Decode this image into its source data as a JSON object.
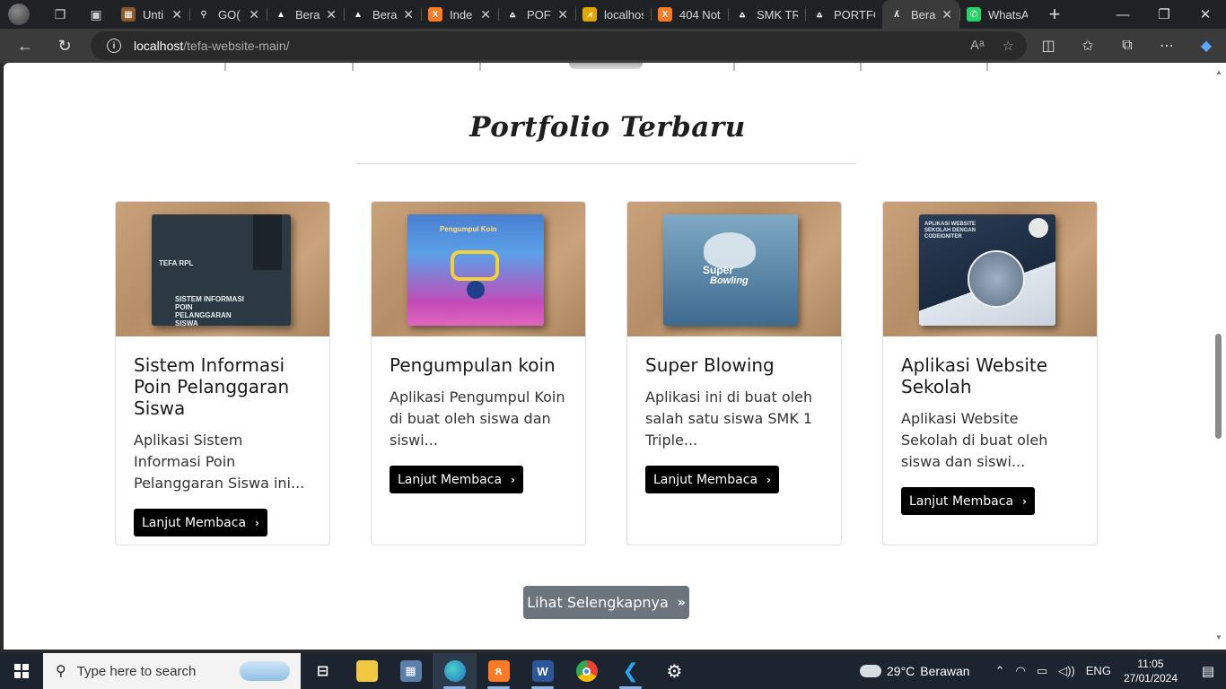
{
  "browser": {
    "tabs": [
      {
        "title": "Unti",
        "fav_color": "#8b5a2b",
        "fav_glyph": "▦",
        "active": false
      },
      {
        "title": "GO(",
        "fav_color": "#202124",
        "fav_glyph": "⚲",
        "active": false
      },
      {
        "title": "Bera",
        "fav_color": "#202124",
        "fav_glyph": "▲",
        "active": false
      },
      {
        "title": "Bera",
        "fav_color": "#202124",
        "fav_glyph": "▲",
        "active": false
      },
      {
        "title": "Inde",
        "fav_color": "#fb7a24",
        "fav_glyph": "X",
        "active": false
      },
      {
        "title": "POF",
        "fav_color": "#202124",
        "fav_glyph": "⩟",
        "active": false
      },
      {
        "title": "localhost",
        "fav_color": "#e0a800",
        "fav_glyph": "⩘",
        "active": false
      },
      {
        "title": "404 Not",
        "fav_color": "#fb7a24",
        "fav_glyph": "X",
        "active": false
      },
      {
        "title": "SMK TRI",
        "fav_color": "#202124",
        "fav_glyph": "⩟",
        "active": false
      },
      {
        "title": "PORTFOI",
        "fav_color": "#202124",
        "fav_glyph": "⩟",
        "active": false
      },
      {
        "title": "Bera",
        "fav_color": "#3b3b3b",
        "fav_glyph": "ʎ",
        "active": true
      },
      {
        "title": "WhatsAp",
        "fav_color": "#25d366",
        "fav_glyph": "✆",
        "active": false
      }
    ],
    "url_host": "localhost",
    "url_path": "/tefa-website-main/"
  },
  "page": {
    "section_title": "Portfolio Terbaru",
    "cards": [
      {
        "title": "Sistem Informasi Poin Pelanggaran Siswa",
        "excerpt": "Aplikasi Sistem Informasi Poin Pelanggaran Siswa ini...",
        "button": "Lanjut Membaca",
        "cover_lines": [
          "TEFA RPL",
          "SISTEM INFORMASI",
          "POIN",
          "PELANGGARAN",
          "SISWA"
        ]
      },
      {
        "title": "Pengumpulan koin",
        "excerpt": "Aplikasi Pengumpul Koin di buat oleh siswa dan siswi...",
        "button": "Lanjut Membaca",
        "cover_lines": [
          "Pengumpul Koin"
        ]
      },
      {
        "title": "Super Blowing",
        "excerpt": "Aplikasi ini di buat oleh salah satu siswa SMK 1 Triple...",
        "button": "Lanjut Membaca",
        "cover_lines": [
          "Super",
          "Bowling"
        ]
      },
      {
        "title": "Aplikasi Website Sekolah",
        "excerpt": "Aplikasi Website Sekolah di buat oleh siswa dan siswi...",
        "button": "Lanjut Membaca",
        "cover_lines": [
          "APLIKASI WEBSITE",
          "SEKOLAH DENGAN",
          "CODEIGNITER"
        ]
      }
    ],
    "more_button": "Lihat Selengkapnya"
  },
  "taskbar": {
    "search_placeholder": "Type here to search",
    "weather_temp": "29°C",
    "weather_desc": "Berawan",
    "lang": "ENG",
    "time": "11:05",
    "date": "27/01/2024"
  }
}
